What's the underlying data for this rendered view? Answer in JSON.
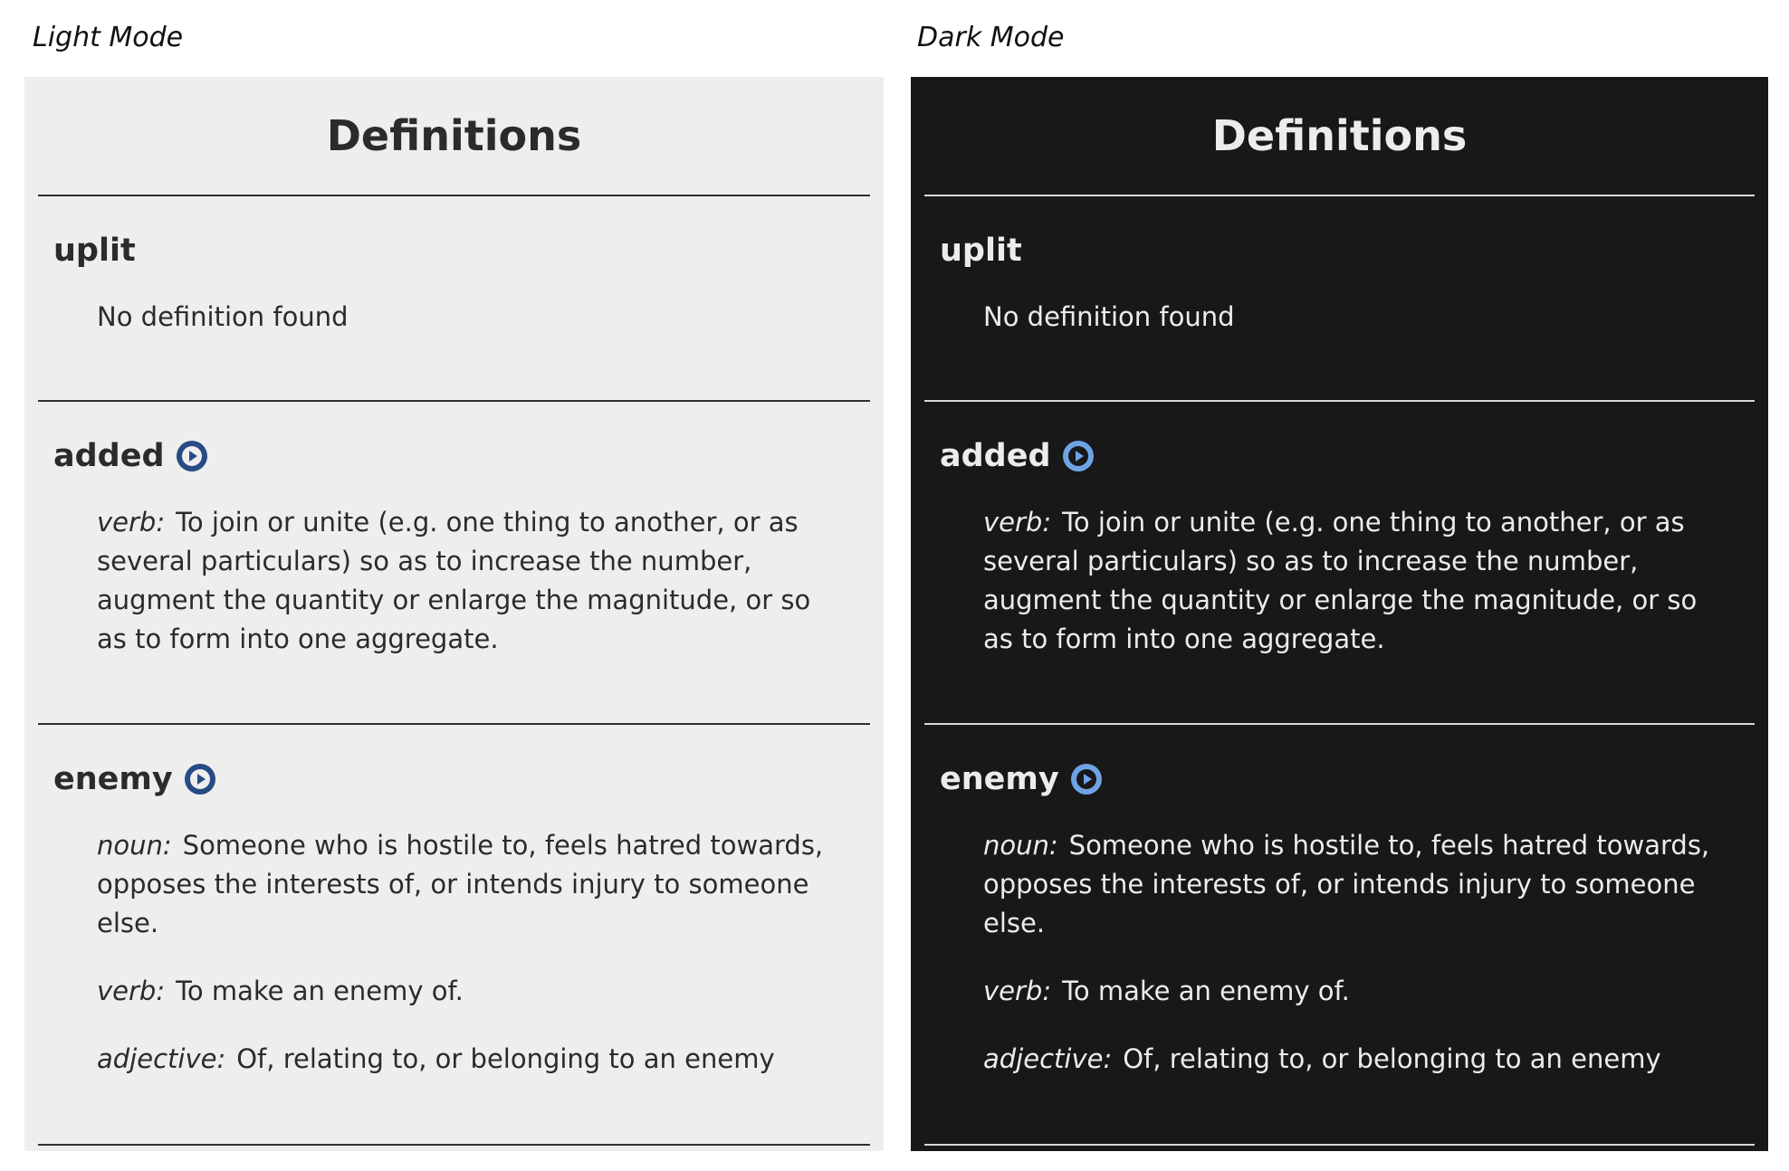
{
  "labels": {
    "light": "Light Mode",
    "dark": "Dark Mode"
  },
  "colors": {
    "light_bg": "#eeeeee",
    "dark_bg": "#181818",
    "light_icon": "#264b85",
    "dark_icon": "#6fa3e6"
  },
  "panel": {
    "title": "Definitions",
    "entries": [
      {
        "word": "uplit",
        "has_audio": false,
        "no_def": "No definition found"
      },
      {
        "word": "added",
        "has_audio": true,
        "defs": [
          {
            "pos": "verb:",
            "text": "To join or unite (e.g. one thing to another, or as several particulars) so as to increase the number, augment the quantity or enlarge the magnitude, or so as to form into one aggregate."
          }
        ]
      },
      {
        "word": "enemy",
        "has_audio": true,
        "defs": [
          {
            "pos": "noun:",
            "text": "Someone who is hostile to, feels hatred towards, opposes the interests of, or intends injury to someone else."
          },
          {
            "pos": "verb:",
            "text": "To make an enemy of."
          },
          {
            "pos": "adjective:",
            "text": "Of, relating to, or belonging to an enemy"
          }
        ]
      }
    ]
  }
}
